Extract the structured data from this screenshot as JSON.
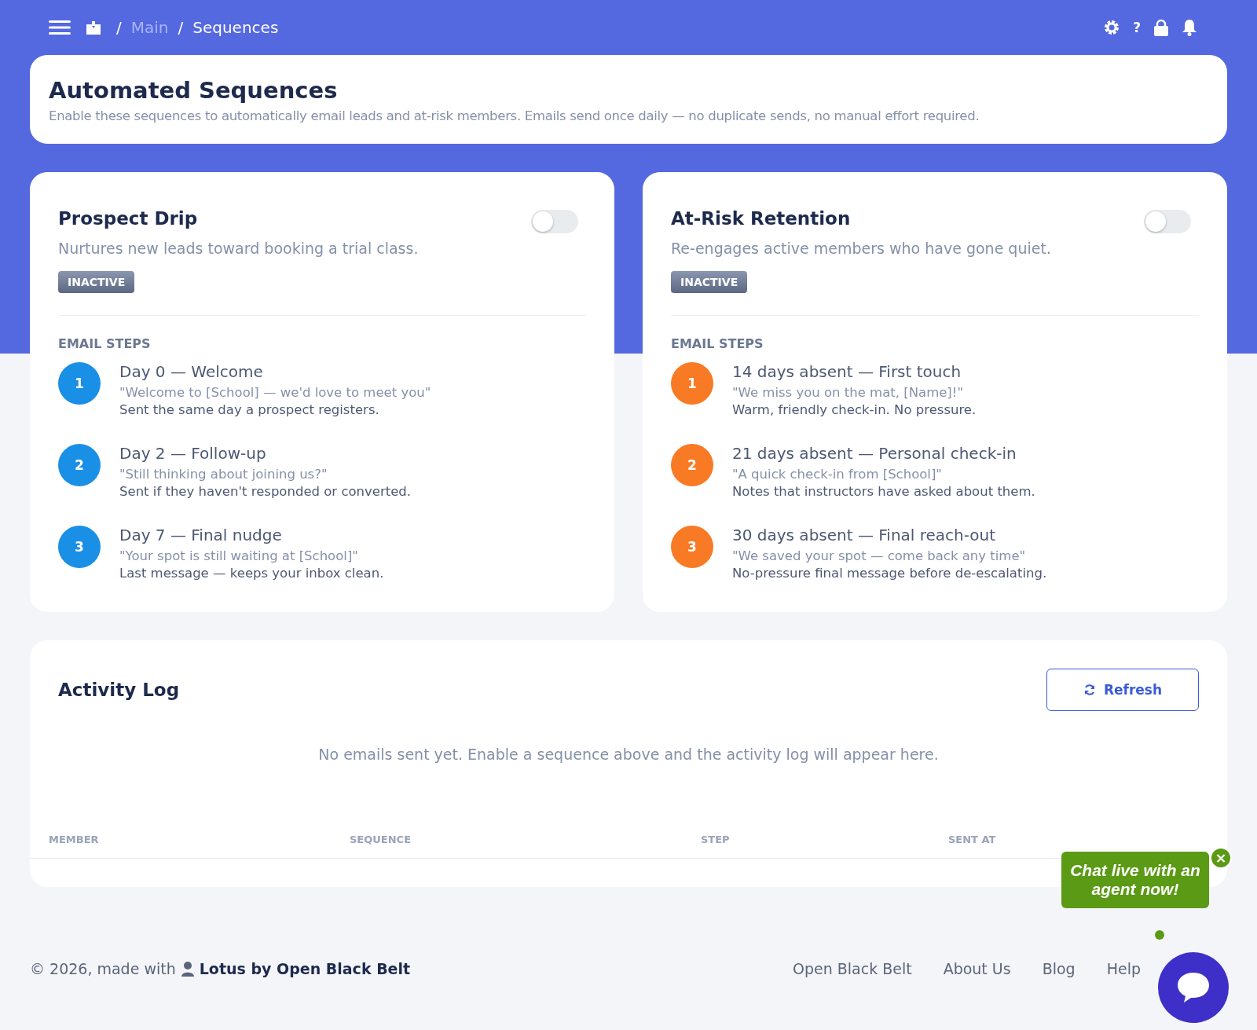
{
  "breadcrumb": [
    {
      "separator": "/",
      "label": "Main",
      "current": false
    },
    {
      "separator": "/",
      "label": "Sequences",
      "current": true
    }
  ],
  "help_label": "?",
  "header": {
    "title": "Automated Sequences",
    "subtitle": "Enable these sequences to automatically email leads and at-risk members. Emails send once daily — no duplicate sends, no manual effort required."
  },
  "sequences": [
    {
      "title": "Prospect Drip",
      "description": "Nurtures new leads toward booking a trial class.",
      "on": false,
      "status": "INACTIVE",
      "steps_label": "EMAIL STEPS",
      "color": "#1a8fe6",
      "steps": [
        {
          "number": "1",
          "title": "Day 0 — Welcome",
          "subject": "\"Welcome to [School] — we'd love to meet you\"",
          "note": "Sent the same day a prospect registers."
        },
        {
          "number": "2",
          "title": "Day 2 — Follow-up",
          "subject": "\"Still thinking about joining us?\"",
          "note": "Sent if they haven't responded or converted."
        },
        {
          "number": "3",
          "title": "Day 7 — Final nudge",
          "subject": "\"Your spot is still waiting at [School]\"",
          "note": "Last message — keeps your inbox clean."
        }
      ]
    },
    {
      "title": "At-Risk Retention",
      "description": "Re-engages active members who have gone quiet.",
      "on": false,
      "status": "INACTIVE",
      "steps_label": "EMAIL STEPS",
      "color": "#f97a24",
      "steps": [
        {
          "number": "1",
          "title": "14 days absent — First touch",
          "subject": "\"We miss you on the mat, [Name]!\"",
          "note": "Warm, friendly check-in. No pressure."
        },
        {
          "number": "2",
          "title": "21 days absent — Personal check-in",
          "subject": "\"A quick check-in from [School]\"",
          "note": "Notes that instructors have asked about them."
        },
        {
          "number": "3",
          "title": "30 days absent — Final reach-out",
          "subject": "\"We saved your spot — come back any time\"",
          "note": "No-pressure final message before de-escalating."
        }
      ]
    }
  ],
  "activity_log": {
    "title": "Activity Log",
    "refresh_label": "Refresh",
    "empty_message": "No emails sent yet. Enable a sequence above and the activity log will appear here.",
    "columns": [
      "MEMBER",
      "SEQUENCE",
      "STEP",
      "SENT AT"
    ]
  },
  "footer": {
    "copyright": "© 2026, made with",
    "brand": "Lotus by Open Black Belt",
    "links": [
      "Open Black Belt",
      "About Us",
      "Blog",
      "Help"
    ]
  },
  "chat": {
    "bubble": "Chat live with an agent now!",
    "close": "×"
  }
}
